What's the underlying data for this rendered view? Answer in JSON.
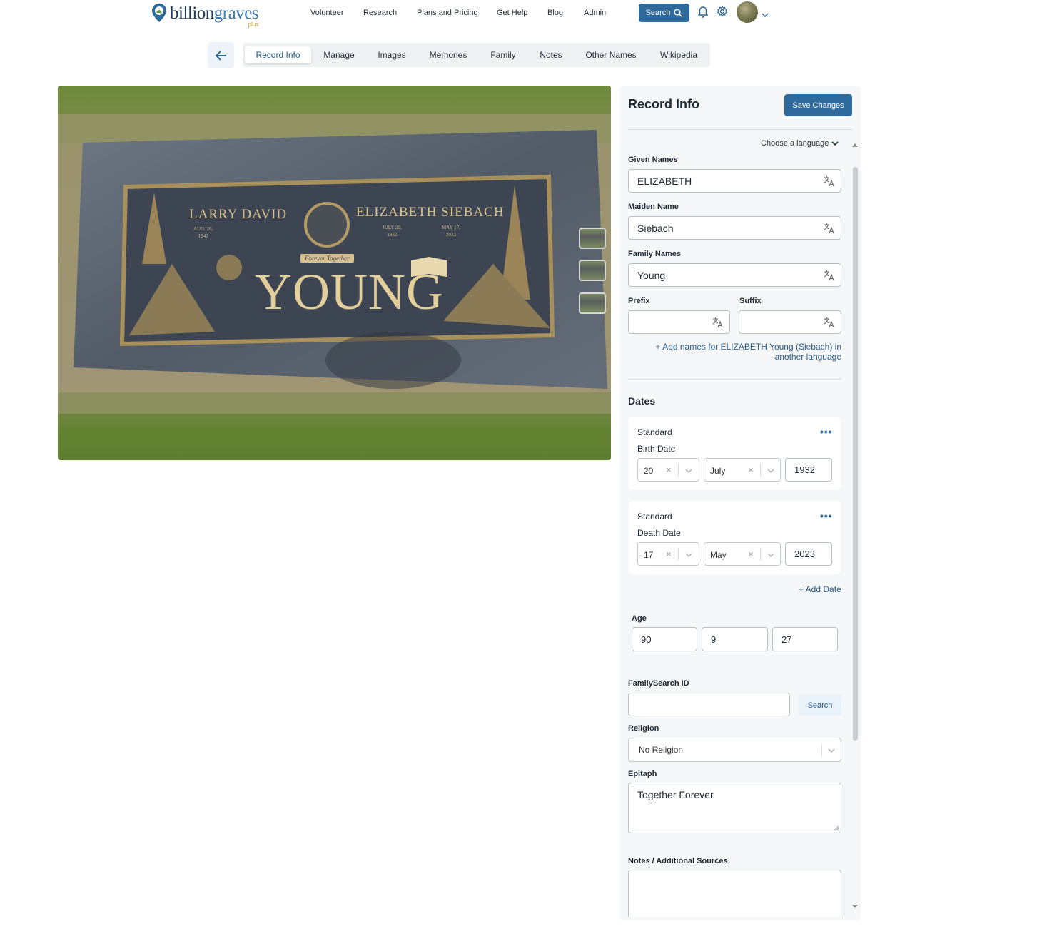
{
  "brand": {
    "name_part1": "billion",
    "name_part2": "graves",
    "plus": "plus"
  },
  "nav": {
    "items": [
      "Volunteer",
      "Research",
      "Plans and Pricing",
      "Get Help",
      "Blog",
      "Admin"
    ],
    "search_label": "Search"
  },
  "tabs": [
    "Record Info",
    "Manage",
    "Images",
    "Memories",
    "Family",
    "Notes",
    "Other Names",
    "Wikipedia"
  ],
  "active_tab": "Record Info",
  "headstone": {
    "name_left": "LARRY DAVID",
    "name_right": "ELIZABETH SIEBACH",
    "dates_left": [
      "AUG. 26,",
      "1942"
    ],
    "dates_right_birth": [
      "JULY 20,",
      "1932"
    ],
    "dates_right_death": [
      "MAY 17,",
      "2023"
    ],
    "banner": "Forever Together",
    "surname": "YOUNG"
  },
  "panel": {
    "title": "Record Info",
    "save_label": "Save Changes",
    "language_label": "Choose a language",
    "given_names_label": "Given Names",
    "given_names_value": "ELIZABETH",
    "maiden_name_label": "Maiden Name",
    "maiden_name_value": "Siebach",
    "family_names_label": "Family Names",
    "family_names_value": "Young",
    "prefix_label": "Prefix",
    "suffix_label": "Suffix",
    "add_names_link": "+ Add names for ELIZABETH Young (Siebach) in another language",
    "dates_heading": "Dates",
    "birth": {
      "type": "Standard",
      "label": "Birth Date",
      "day": "20",
      "month": "July",
      "year": "1932"
    },
    "death": {
      "type": "Standard",
      "label": "Death Date",
      "day": "17",
      "month": "May",
      "year": "2023"
    },
    "add_date_link": "+ Add Date",
    "age_label": "Age",
    "age_values": [
      "90",
      "9",
      "27"
    ],
    "familysearch_label": "FamilySearch ID",
    "familysearch_value": "",
    "familysearch_search": "Search",
    "religion_label": "Religion",
    "religion_value": "No Religion",
    "epitaph_label": "Epitaph",
    "epitaph_value": "Together Forever",
    "notes_label": "Notes / Additional Sources",
    "notes_value": ""
  },
  "colors": {
    "primary": "#2f6a9c",
    "link": "#2a5d8a",
    "panel_bg": "#f6f7f8"
  }
}
